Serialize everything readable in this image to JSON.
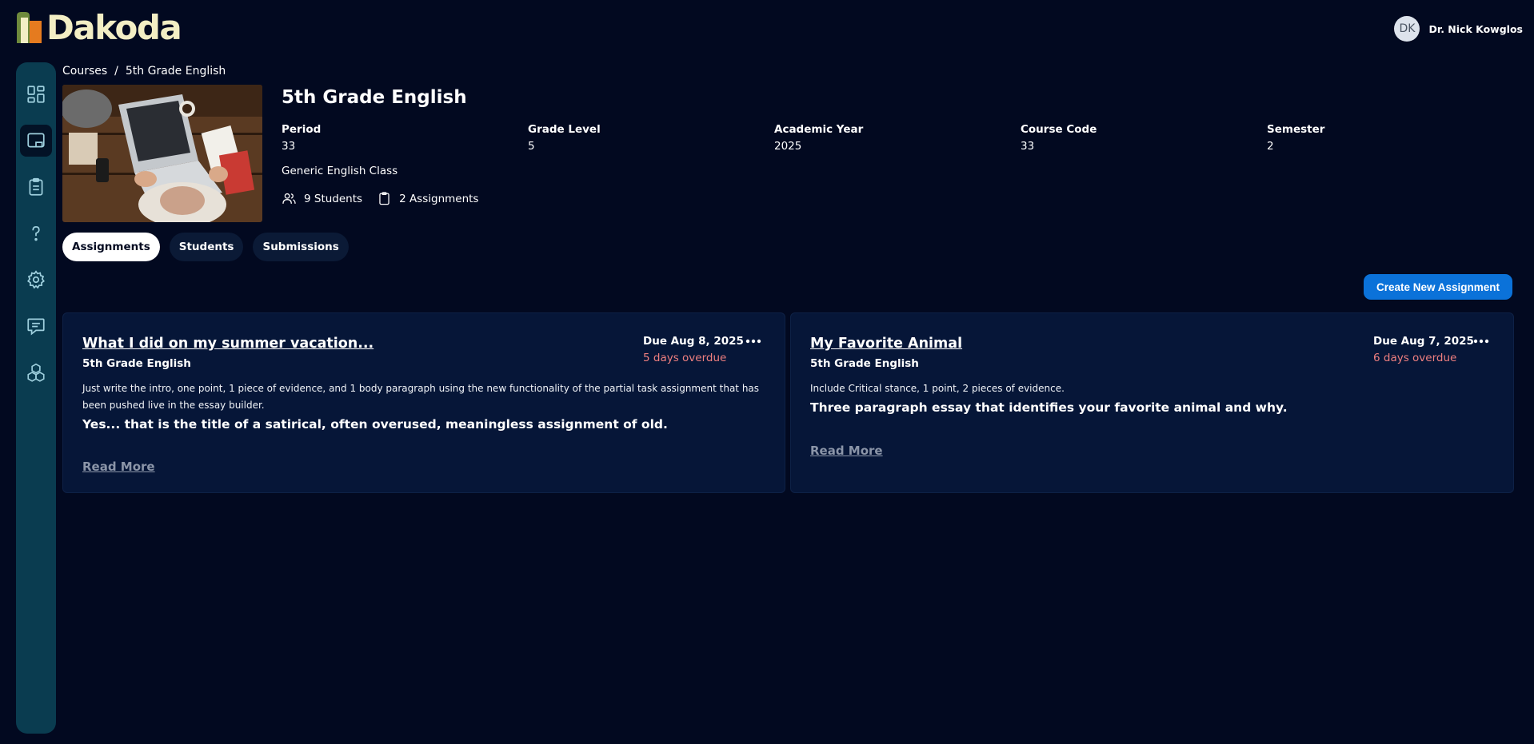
{
  "app": {
    "name": "Dakoda",
    "brand_color": "#f3eec4"
  },
  "user": {
    "initials": "DK",
    "name": "Dr. Nick Kowglos"
  },
  "sidebar": {
    "items": [
      {
        "icon": "dashboard-icon",
        "active": false
      },
      {
        "icon": "classroom-icon",
        "active": true
      },
      {
        "icon": "clipboard-icon",
        "active": false
      },
      {
        "icon": "help-icon",
        "active": false
      },
      {
        "icon": "gear-icon",
        "active": false
      },
      {
        "icon": "chat-icon",
        "active": false
      },
      {
        "icon": "cubes-icon",
        "active": false
      }
    ]
  },
  "breadcrumb": {
    "root": "Courses",
    "separator": "/",
    "current": "5th Grade English"
  },
  "course": {
    "title": "5th Grade English",
    "meta": [
      {
        "label": "Period",
        "value": "33"
      },
      {
        "label": "Grade Level",
        "value": "5"
      },
      {
        "label": "Academic Year",
        "value": "2025"
      },
      {
        "label": "Course Code",
        "value": "33"
      },
      {
        "label": "Semester",
        "value": "2"
      }
    ],
    "description": "Generic English Class",
    "students": "9 Students",
    "assignments": "2 Assignments"
  },
  "tabs": [
    {
      "label": "Assignments",
      "active": true
    },
    {
      "label": "Students",
      "active": false
    },
    {
      "label": "Submissions",
      "active": false
    }
  ],
  "create_button": "Create New Assignment",
  "assignment_cards": [
    {
      "title": "What I did on my summer vacation...",
      "course": "5th Grade English",
      "due": "Due Aug 8, 2025",
      "overdue": "5 days overdue",
      "instructions": "Just write the intro, one point, 1 piece of evidence, and 1 body paragraph using the new functionality of the partial task assignment that has been pushed live in the essay builder.",
      "description": "Yes... that is the title of a satirical, often overused, meaningless assignment of old.",
      "read_more": "Read More"
    },
    {
      "title": "My Favorite Animal",
      "course": "5th Grade English",
      "due": "Due Aug 7, 2025",
      "overdue": "6 days overdue",
      "instructions": "Include Critical stance, 1 point, 2 pieces of evidence.",
      "description": "Three paragraph essay that identifies your favorite animal and why.",
      "read_more": "Read More"
    }
  ],
  "colors": {
    "background": "#020920",
    "sidebar": "#0a3c50",
    "card": "#061638",
    "accent": "#0b72d9",
    "overdue": "#ef7f7f"
  }
}
